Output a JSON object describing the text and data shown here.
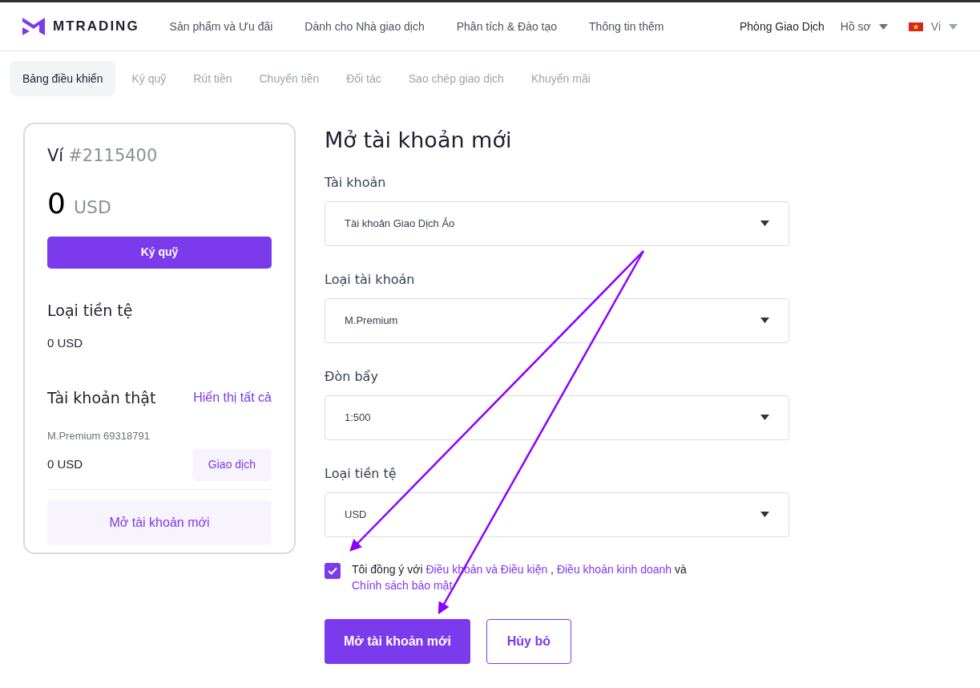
{
  "header": {
    "logo_text": "MTRADING",
    "nav": [
      "Sản phẩm và Ưu đãi",
      "Dành cho Nhà giao dịch",
      "Phân tích & Đào tạo",
      "Thông tin thêm"
    ],
    "trading_room": "Phòng Giao Dịch",
    "profile": "Hồ sơ",
    "language": "Vi"
  },
  "tabs": [
    {
      "label": "Bảng điều khiển",
      "selected": true
    },
    {
      "label": "Ký quỹ",
      "selected": false
    },
    {
      "label": "Rút tiền",
      "selected": false
    },
    {
      "label": "Chuyển tiền",
      "selected": false
    },
    {
      "label": "Đối tác",
      "selected": false
    },
    {
      "label": "Sao chép giao dịch",
      "selected": false
    },
    {
      "label": "Khuyến mãi",
      "selected": false
    }
  ],
  "wallet": {
    "title": "Ví",
    "number": "#2115400",
    "balance": "0",
    "currency": "USD",
    "deposit_button": "Ký quỹ",
    "currency_heading": "Loại tiền tệ",
    "currency_value": "0 USD",
    "real_accounts_heading": "Tài khoản thật",
    "show_all_link": "Hiển thị tất cả",
    "account": {
      "name": "M.Premium 69318791",
      "balance": "0 USD",
      "trade_button": "Giao dịch"
    },
    "new_account_button": "Mở tài khoản mới"
  },
  "form": {
    "title": "Mở tài khoản mới",
    "fields": [
      {
        "label": "Tài khoản",
        "value": "Tài khoản Giao Dịch Ảo"
      },
      {
        "label": "Loại tài khoản",
        "value": "M.Premium"
      },
      {
        "label": "Đòn bẩy",
        "value": "1:500"
      },
      {
        "label": "Loại tiền tệ",
        "value": "USD"
      }
    ],
    "agreement": {
      "checked": true,
      "parts": [
        {
          "kind": "text",
          "text": "Tôi đồng ý với"
        },
        {
          "kind": "link",
          "text": "Điều khoản và Điều kiện"
        },
        {
          "kind": "text",
          "text": ","
        },
        {
          "kind": "link",
          "text": "Điều khoản kinh doanh"
        },
        {
          "kind": "text",
          "text": "và"
        },
        {
          "kind": "link",
          "text": "Chính sách bảo mật"
        }
      ]
    },
    "submit": "Mở tài khoản mới",
    "cancel": "Hủy bỏ"
  }
}
